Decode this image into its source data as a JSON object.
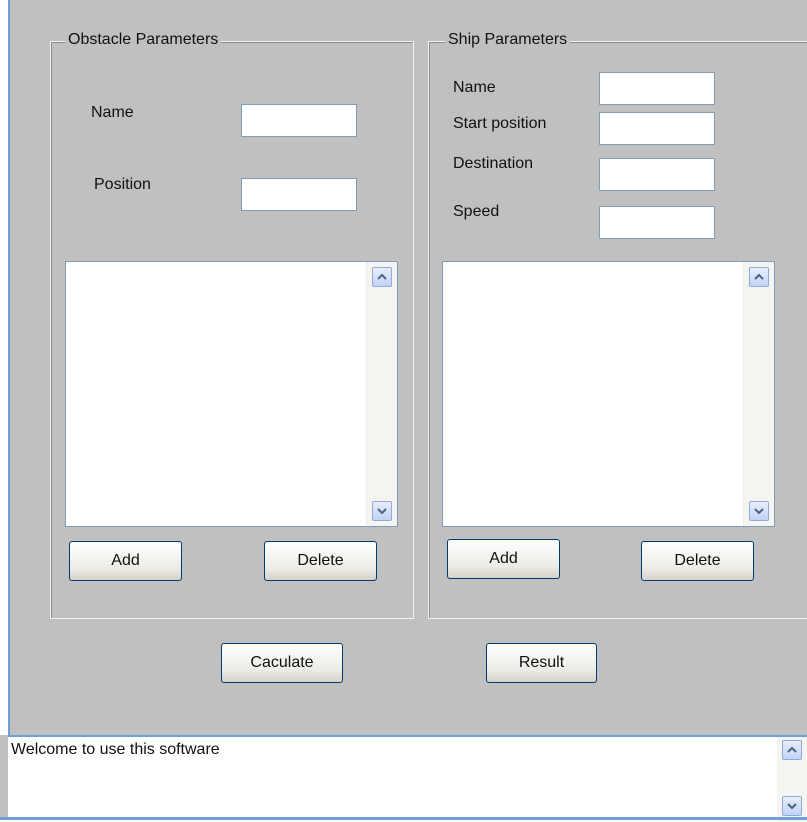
{
  "obstacle": {
    "title": "Obstacle Parameters",
    "name_label": "Name",
    "name_value": "",
    "position_label": "Position",
    "position_value": "",
    "add_label": "Add",
    "delete_label": "Delete",
    "list_items": []
  },
  "ship": {
    "title": "Ship Parameters",
    "name_label": "Name",
    "name_value": "",
    "start_label": "Start position",
    "start_value": "",
    "destination_label": "Destination",
    "destination_value": "",
    "speed_label": "Speed",
    "speed_value": "",
    "add_label": "Add",
    "delete_label": "Delete",
    "list_items": []
  },
  "actions": {
    "calculate_label": "Caculate",
    "result_label": "Result"
  },
  "status": {
    "message": "Welcome to use this software"
  },
  "icons": {
    "scroll_up": "chevron-up-icon",
    "scroll_down": "chevron-down-icon"
  },
  "colors": {
    "window_bg": "#c0c0c0",
    "accent_blue": "#6f9ed8",
    "button_border": "#003c74",
    "field_border": "#7f9db9"
  }
}
